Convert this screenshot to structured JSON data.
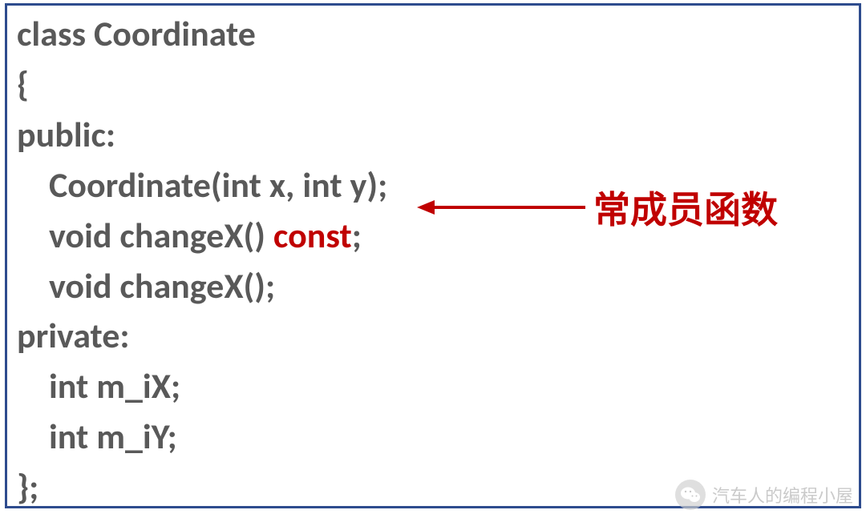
{
  "code": {
    "line1": "class Coordinate",
    "line2": "{",
    "line3": "public:",
    "line4": "Coordinate(int x, int y);",
    "line5_prefix": "void changeX() ",
    "line5_const": "const",
    "line5_suffix": ";",
    "line6": "void changeX();",
    "line7": "private:",
    "line8": "int m_iX;",
    "line9": "int m_iY;",
    "line10": "};"
  },
  "annotation": {
    "label": "常成员函数"
  },
  "watermark": {
    "text": "汽车人的编程小屋"
  },
  "colors": {
    "border": "#2e4c8e",
    "text": "#595959",
    "highlight": "#c00000"
  }
}
